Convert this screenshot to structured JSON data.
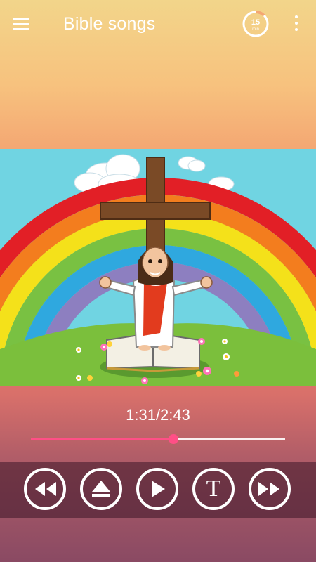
{
  "appbar": {
    "title": "Bible songs",
    "timer_value": "15",
    "timer_unit": "min"
  },
  "player": {
    "time_display": "1:31/2:43",
    "progress": 0.56,
    "controls": {
      "text_label": "T"
    }
  },
  "colors": {
    "accent": "#ff4f86",
    "controls_bg": "#3c1628"
  },
  "icons": [
    "menu-icon",
    "timer-icon",
    "more-vert-icon",
    "rewind-icon",
    "eject-icon",
    "play-icon",
    "text-icon",
    "fast-forward-icon"
  ]
}
